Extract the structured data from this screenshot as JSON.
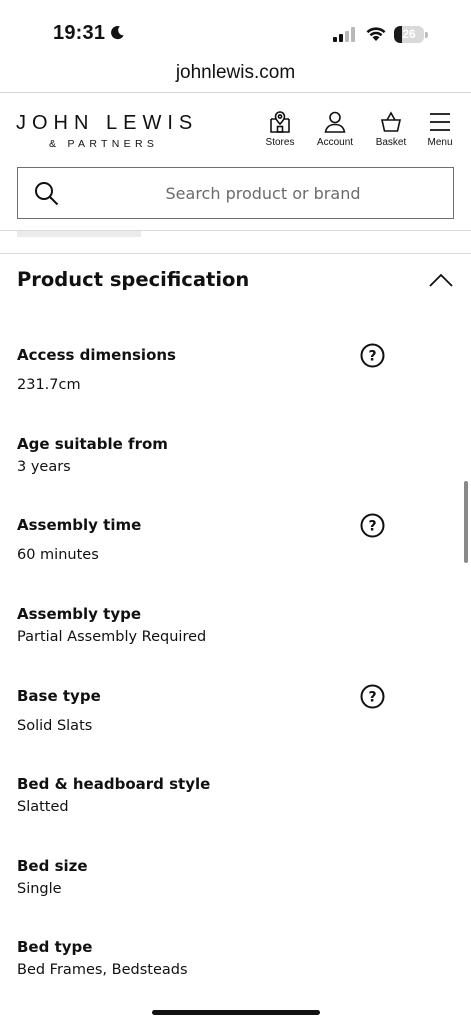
{
  "status_bar": {
    "time": "19:31",
    "battery_level": "26",
    "battery_fraction": 0.26
  },
  "browser": {
    "url": "johnlewis.com"
  },
  "header": {
    "brand_name": "JOHN LEWIS",
    "brand_sub": "& PARTNERS",
    "nav": [
      {
        "label": "Stores",
        "icon": "store-icon"
      },
      {
        "label": "Account",
        "icon": "account-icon"
      },
      {
        "label": "Basket",
        "icon": "basket-icon"
      },
      {
        "label": "Menu",
        "icon": "menu-icon"
      }
    ]
  },
  "search": {
    "placeholder": "Search product or brand",
    "value": ""
  },
  "section": {
    "title": "Product specification",
    "expanded": true
  },
  "specs": [
    {
      "label": "Access dimensions",
      "value": "231.7cm",
      "help": true
    },
    {
      "label": "Age suitable from",
      "value": "3 years",
      "help": false
    },
    {
      "label": "Assembly time",
      "value": "60 minutes",
      "help": true
    },
    {
      "label": "Assembly type",
      "value": "Partial Assembly Required",
      "help": false
    },
    {
      "label": "Base type",
      "value": "Solid Slats",
      "help": true
    },
    {
      "label": "Bed & headboard style",
      "value": "Slatted",
      "help": false
    },
    {
      "label": "Bed size",
      "value": "Single",
      "help": false
    },
    {
      "label": "Bed type",
      "value": "Bed Frames, Bedsteads",
      "help": false
    }
  ],
  "colors": {
    "text": "#111111",
    "border": "#707070",
    "divider": "#dcdcdc"
  }
}
